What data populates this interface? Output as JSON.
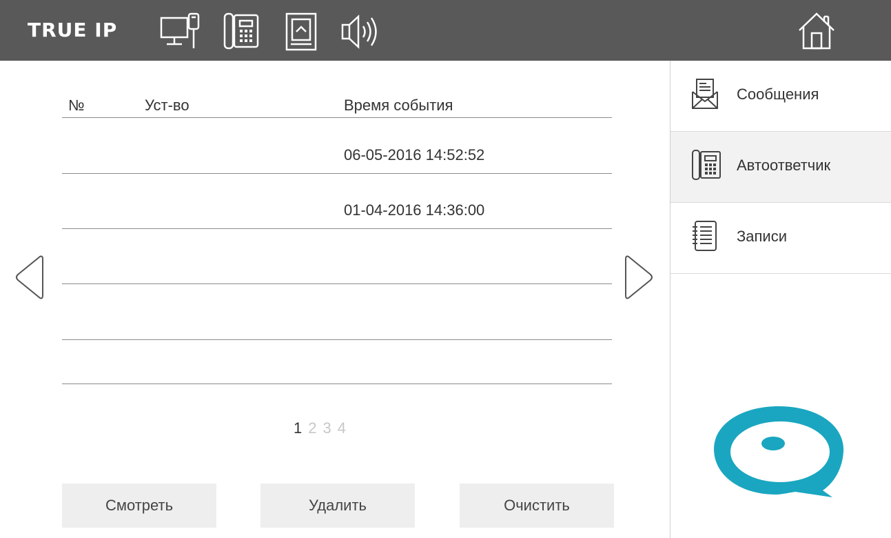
{
  "header": {
    "brand": "TRUE IP",
    "icons": [
      "monitor-icon",
      "intercom-icon",
      "sd-card-icon",
      "speaker-icon",
      "home-icon"
    ]
  },
  "table": {
    "columns": [
      "№",
      "Уст-во",
      "Время события"
    ],
    "rows": [
      {
        "num": "",
        "device": "",
        "time": "06-05-2016 14:52:52"
      },
      {
        "num": "",
        "device": "",
        "time": "01-04-2016 14:36:00"
      },
      {
        "num": "",
        "device": "",
        "time": ""
      },
      {
        "num": "",
        "device": "",
        "time": ""
      },
      {
        "num": "",
        "device": "",
        "time": ""
      }
    ]
  },
  "pagination": {
    "pages": [
      "1",
      "2",
      "3",
      "4"
    ],
    "current": "1"
  },
  "buttons": {
    "view": "Смотреть",
    "delete": "Удалить",
    "clear": "Очистить"
  },
  "sidebar": {
    "items": [
      {
        "label": "Сообщения",
        "icon": "envelope-icon",
        "active": false
      },
      {
        "label": "Автоответчик",
        "icon": "answering-machine-icon",
        "active": true
      },
      {
        "label": "Записи",
        "icon": "notebook-icon",
        "active": false
      }
    ]
  },
  "colors": {
    "topbar": "#595959",
    "active_item": "#f2f2f2",
    "button": "#eeeeee",
    "logo": "#1aa6c0"
  }
}
